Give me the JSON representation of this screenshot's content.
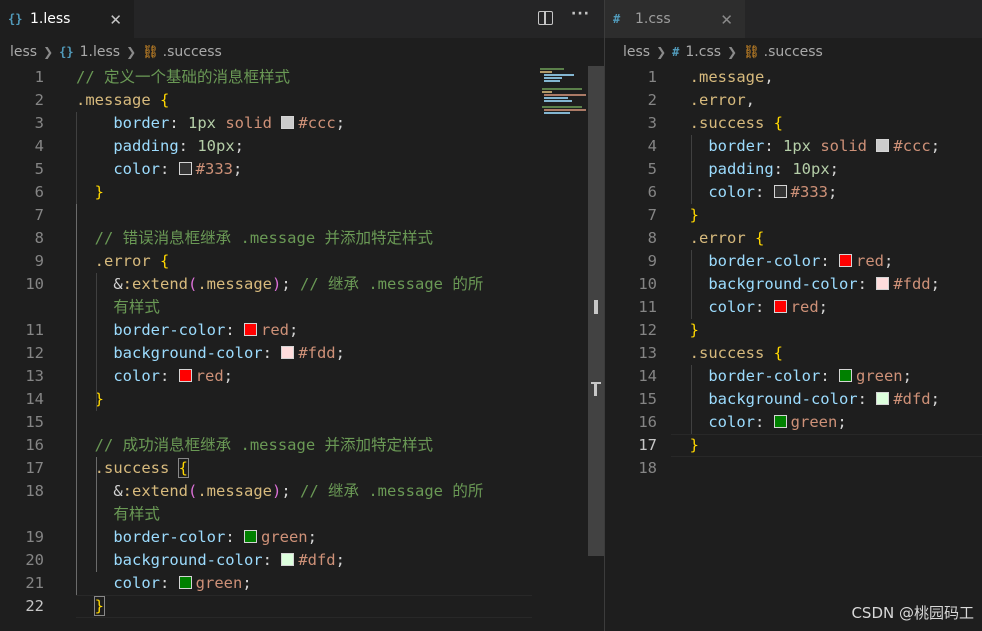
{
  "left": {
    "tab": {
      "icon": "{}",
      "name": "1.less",
      "close": "✕"
    },
    "actions": {
      "more": "···"
    },
    "breadcrumb": {
      "folder": "less",
      "file_icon": "{}",
      "file": "1.less",
      "symbol": ".success"
    },
    "current_line": 22,
    "lines": [
      {
        "n": "1",
        "tokens": [
          {
            "t": "comment",
            "v": "// 定义一个基础的消息框样式"
          }
        ]
      },
      {
        "n": "2",
        "tokens": [
          {
            "t": "sel",
            "v": ".message"
          },
          {
            "t": "punc",
            "v": " "
          },
          {
            "t": "brace",
            "v": "{"
          }
        ]
      },
      {
        "n": "3",
        "tokens": [
          {
            "t": "punc",
            "v": "    "
          },
          {
            "t": "prop",
            "v": "border"
          },
          {
            "t": "punc",
            "v": ": "
          },
          {
            "t": "num",
            "v": "1px"
          },
          {
            "t": "punc",
            "v": " "
          },
          {
            "t": "val",
            "v": "solid"
          },
          {
            "t": "punc",
            "v": " "
          },
          {
            "t": "swatch",
            "v": "#cccccc"
          },
          {
            "t": "val",
            "v": "#ccc"
          },
          {
            "t": "punc",
            "v": ";"
          }
        ]
      },
      {
        "n": "4",
        "tokens": [
          {
            "t": "punc",
            "v": "    "
          },
          {
            "t": "prop",
            "v": "padding"
          },
          {
            "t": "punc",
            "v": ": "
          },
          {
            "t": "num",
            "v": "10px"
          },
          {
            "t": "punc",
            "v": ";"
          }
        ]
      },
      {
        "n": "5",
        "tokens": [
          {
            "t": "punc",
            "v": "    "
          },
          {
            "t": "prop",
            "v": "color"
          },
          {
            "t": "punc",
            "v": ": "
          },
          {
            "t": "swatch",
            "v": "#333333"
          },
          {
            "t": "val",
            "v": "#333"
          },
          {
            "t": "punc",
            "v": ";"
          }
        ]
      },
      {
        "n": "6",
        "tokens": [
          {
            "t": "punc",
            "v": "  "
          },
          {
            "t": "brace",
            "v": "}"
          }
        ]
      },
      {
        "n": "7",
        "tokens": []
      },
      {
        "n": "8",
        "tokens": [
          {
            "t": "punc",
            "v": "  "
          },
          {
            "t": "comment",
            "v": "// 错误消息框继承 .message 并添加特定样式"
          }
        ]
      },
      {
        "n": "9",
        "tokens": [
          {
            "t": "punc",
            "v": "  "
          },
          {
            "t": "sel",
            "v": ".error"
          },
          {
            "t": "punc",
            "v": " "
          },
          {
            "t": "brace",
            "v": "{"
          }
        ]
      },
      {
        "n": "10",
        "tokens": [
          {
            "t": "punc",
            "v": "    "
          },
          {
            "t": "amp",
            "v": "&"
          },
          {
            "t": "sel",
            "v": ":extend"
          },
          {
            "t": "paren",
            "v": "("
          },
          {
            "t": "sel",
            "v": ".message"
          },
          {
            "t": "paren",
            "v": ")"
          },
          {
            "t": "punc",
            "v": "; "
          },
          {
            "t": "comment",
            "v": "// 继承 .message 的所"
          }
        ]
      },
      {
        "n": "",
        "tokens": [
          {
            "t": "punc",
            "v": "    "
          },
          {
            "t": "comment",
            "v": "有样式"
          }
        ]
      },
      {
        "n": "11",
        "tokens": [
          {
            "t": "punc",
            "v": "    "
          },
          {
            "t": "prop",
            "v": "border-color"
          },
          {
            "t": "punc",
            "v": ": "
          },
          {
            "t": "swatch",
            "v": "#ff0000"
          },
          {
            "t": "val",
            "v": "red"
          },
          {
            "t": "punc",
            "v": ";"
          }
        ]
      },
      {
        "n": "12",
        "tokens": [
          {
            "t": "punc",
            "v": "    "
          },
          {
            "t": "prop",
            "v": "background-color"
          },
          {
            "t": "punc",
            "v": ": "
          },
          {
            "t": "swatch",
            "v": "#ffdddd"
          },
          {
            "t": "val",
            "v": "#fdd"
          },
          {
            "t": "punc",
            "v": ";"
          }
        ]
      },
      {
        "n": "13",
        "tokens": [
          {
            "t": "punc",
            "v": "    "
          },
          {
            "t": "prop",
            "v": "color"
          },
          {
            "t": "punc",
            "v": ": "
          },
          {
            "t": "swatch",
            "v": "#ff0000"
          },
          {
            "t": "val",
            "v": "red"
          },
          {
            "t": "punc",
            "v": ";"
          }
        ]
      },
      {
        "n": "14",
        "tokens": [
          {
            "t": "punc",
            "v": "  "
          },
          {
            "t": "brace",
            "v": "}"
          }
        ]
      },
      {
        "n": "15",
        "tokens": []
      },
      {
        "n": "16",
        "tokens": [
          {
            "t": "punc",
            "v": "  "
          },
          {
            "t": "comment",
            "v": "// 成功消息框继承 .message 并添加特定样式"
          }
        ]
      },
      {
        "n": "17",
        "tokens": [
          {
            "t": "punc",
            "v": "  "
          },
          {
            "t": "sel",
            "v": ".success"
          },
          {
            "t": "punc",
            "v": " "
          },
          {
            "t": "brace-match",
            "v": "{"
          }
        ]
      },
      {
        "n": "18",
        "tokens": [
          {
            "t": "punc",
            "v": "    "
          },
          {
            "t": "amp",
            "v": "&"
          },
          {
            "t": "sel",
            "v": ":extend"
          },
          {
            "t": "paren",
            "v": "("
          },
          {
            "t": "sel",
            "v": ".message"
          },
          {
            "t": "paren",
            "v": ")"
          },
          {
            "t": "punc",
            "v": "; "
          },
          {
            "t": "comment",
            "v": "// 继承 .message 的所"
          }
        ]
      },
      {
        "n": "",
        "tokens": [
          {
            "t": "punc",
            "v": "    "
          },
          {
            "t": "comment",
            "v": "有样式"
          }
        ]
      },
      {
        "n": "19",
        "tokens": [
          {
            "t": "punc",
            "v": "    "
          },
          {
            "t": "prop",
            "v": "border-color"
          },
          {
            "t": "punc",
            "v": ": "
          },
          {
            "t": "swatch",
            "v": "#008000"
          },
          {
            "t": "val",
            "v": "green"
          },
          {
            "t": "punc",
            "v": ";"
          }
        ]
      },
      {
        "n": "20",
        "tokens": [
          {
            "t": "punc",
            "v": "    "
          },
          {
            "t": "prop",
            "v": "background-color"
          },
          {
            "t": "punc",
            "v": ": "
          },
          {
            "t": "swatch",
            "v": "#ddffdd"
          },
          {
            "t": "val",
            "v": "#dfd"
          },
          {
            "t": "punc",
            "v": ";"
          }
        ]
      },
      {
        "n": "21",
        "tokens": [
          {
            "t": "punc",
            "v": "    "
          },
          {
            "t": "prop",
            "v": "color"
          },
          {
            "t": "punc",
            "v": ": "
          },
          {
            "t": "swatch",
            "v": "#008000"
          },
          {
            "t": "val",
            "v": "green"
          },
          {
            "t": "punc",
            "v": ";"
          }
        ]
      },
      {
        "n": "22",
        "tokens": [
          {
            "t": "punc",
            "v": "  "
          },
          {
            "t": "brace-match",
            "v": "}"
          }
        ]
      }
    ]
  },
  "right": {
    "tab": {
      "icon": "#",
      "name": "1.css",
      "close": "✕"
    },
    "breadcrumb": {
      "folder": "less",
      "file_icon": "#",
      "file": "1.css",
      "symbol": ".success"
    },
    "current_line": 17,
    "lines": [
      {
        "n": "1",
        "tokens": [
          {
            "t": "punc",
            "v": "  "
          },
          {
            "t": "sel",
            "v": ".message"
          },
          {
            "t": "punc",
            "v": ","
          }
        ]
      },
      {
        "n": "2",
        "tokens": [
          {
            "t": "punc",
            "v": "  "
          },
          {
            "t": "sel",
            "v": ".error"
          },
          {
            "t": "punc",
            "v": ","
          }
        ]
      },
      {
        "n": "3",
        "tokens": [
          {
            "t": "punc",
            "v": "  "
          },
          {
            "t": "sel",
            "v": ".success"
          },
          {
            "t": "punc",
            "v": " "
          },
          {
            "t": "brace",
            "v": "{"
          }
        ]
      },
      {
        "n": "4",
        "tokens": [
          {
            "t": "punc",
            "v": "    "
          },
          {
            "t": "prop",
            "v": "border"
          },
          {
            "t": "punc",
            "v": ": "
          },
          {
            "t": "num",
            "v": "1px"
          },
          {
            "t": "punc",
            "v": " "
          },
          {
            "t": "val",
            "v": "solid"
          },
          {
            "t": "punc",
            "v": " "
          },
          {
            "t": "swatch",
            "v": "#cccccc"
          },
          {
            "t": "val",
            "v": "#ccc"
          },
          {
            "t": "punc",
            "v": ";"
          }
        ]
      },
      {
        "n": "5",
        "tokens": [
          {
            "t": "punc",
            "v": "    "
          },
          {
            "t": "prop",
            "v": "padding"
          },
          {
            "t": "punc",
            "v": ": "
          },
          {
            "t": "num",
            "v": "10px"
          },
          {
            "t": "punc",
            "v": ";"
          }
        ]
      },
      {
        "n": "6",
        "tokens": [
          {
            "t": "punc",
            "v": "    "
          },
          {
            "t": "prop",
            "v": "color"
          },
          {
            "t": "punc",
            "v": ": "
          },
          {
            "t": "swatch",
            "v": "#333333"
          },
          {
            "t": "val",
            "v": "#333"
          },
          {
            "t": "punc",
            "v": ";"
          }
        ]
      },
      {
        "n": "7",
        "tokens": [
          {
            "t": "punc",
            "v": "  "
          },
          {
            "t": "brace",
            "v": "}"
          }
        ]
      },
      {
        "n": "8",
        "tokens": [
          {
            "t": "punc",
            "v": "  "
          },
          {
            "t": "sel",
            "v": ".error"
          },
          {
            "t": "punc",
            "v": " "
          },
          {
            "t": "brace",
            "v": "{"
          }
        ]
      },
      {
        "n": "9",
        "tokens": [
          {
            "t": "punc",
            "v": "    "
          },
          {
            "t": "prop",
            "v": "border-color"
          },
          {
            "t": "punc",
            "v": ": "
          },
          {
            "t": "swatch",
            "v": "#ff0000"
          },
          {
            "t": "val",
            "v": "red"
          },
          {
            "t": "punc",
            "v": ";"
          }
        ]
      },
      {
        "n": "10",
        "tokens": [
          {
            "t": "punc",
            "v": "    "
          },
          {
            "t": "prop",
            "v": "background-color"
          },
          {
            "t": "punc",
            "v": ": "
          },
          {
            "t": "swatch",
            "v": "#ffdddd"
          },
          {
            "t": "val",
            "v": "#fdd"
          },
          {
            "t": "punc",
            "v": ";"
          }
        ]
      },
      {
        "n": "11",
        "tokens": [
          {
            "t": "punc",
            "v": "    "
          },
          {
            "t": "prop",
            "v": "color"
          },
          {
            "t": "punc",
            "v": ": "
          },
          {
            "t": "swatch",
            "v": "#ff0000"
          },
          {
            "t": "val",
            "v": "red"
          },
          {
            "t": "punc",
            "v": ";"
          }
        ]
      },
      {
        "n": "12",
        "tokens": [
          {
            "t": "punc",
            "v": "  "
          },
          {
            "t": "brace",
            "v": "}"
          }
        ]
      },
      {
        "n": "13",
        "tokens": [
          {
            "t": "punc",
            "v": "  "
          },
          {
            "t": "sel",
            "v": ".success"
          },
          {
            "t": "punc",
            "v": " "
          },
          {
            "t": "brace",
            "v": "{"
          }
        ]
      },
      {
        "n": "14",
        "tokens": [
          {
            "t": "punc",
            "v": "    "
          },
          {
            "t": "prop",
            "v": "border-color"
          },
          {
            "t": "punc",
            "v": ": "
          },
          {
            "t": "swatch",
            "v": "#008000"
          },
          {
            "t": "val",
            "v": "green"
          },
          {
            "t": "punc",
            "v": ";"
          }
        ]
      },
      {
        "n": "15",
        "tokens": [
          {
            "t": "punc",
            "v": "    "
          },
          {
            "t": "prop",
            "v": "background-color"
          },
          {
            "t": "punc",
            "v": ": "
          },
          {
            "t": "swatch",
            "v": "#ddffdd"
          },
          {
            "t": "val",
            "v": "#dfd"
          },
          {
            "t": "punc",
            "v": ";"
          }
        ]
      },
      {
        "n": "16",
        "tokens": [
          {
            "t": "punc",
            "v": "    "
          },
          {
            "t": "prop",
            "v": "color"
          },
          {
            "t": "punc",
            "v": ": "
          },
          {
            "t": "swatch",
            "v": "#008000"
          },
          {
            "t": "val",
            "v": "green"
          },
          {
            "t": "punc",
            "v": ";"
          }
        ]
      },
      {
        "n": "17",
        "tokens": [
          {
            "t": "punc",
            "v": "  "
          },
          {
            "t": "brace",
            "v": "}"
          }
        ]
      },
      {
        "n": "18",
        "tokens": []
      }
    ]
  },
  "watermark": "CSDN @桃园码工"
}
